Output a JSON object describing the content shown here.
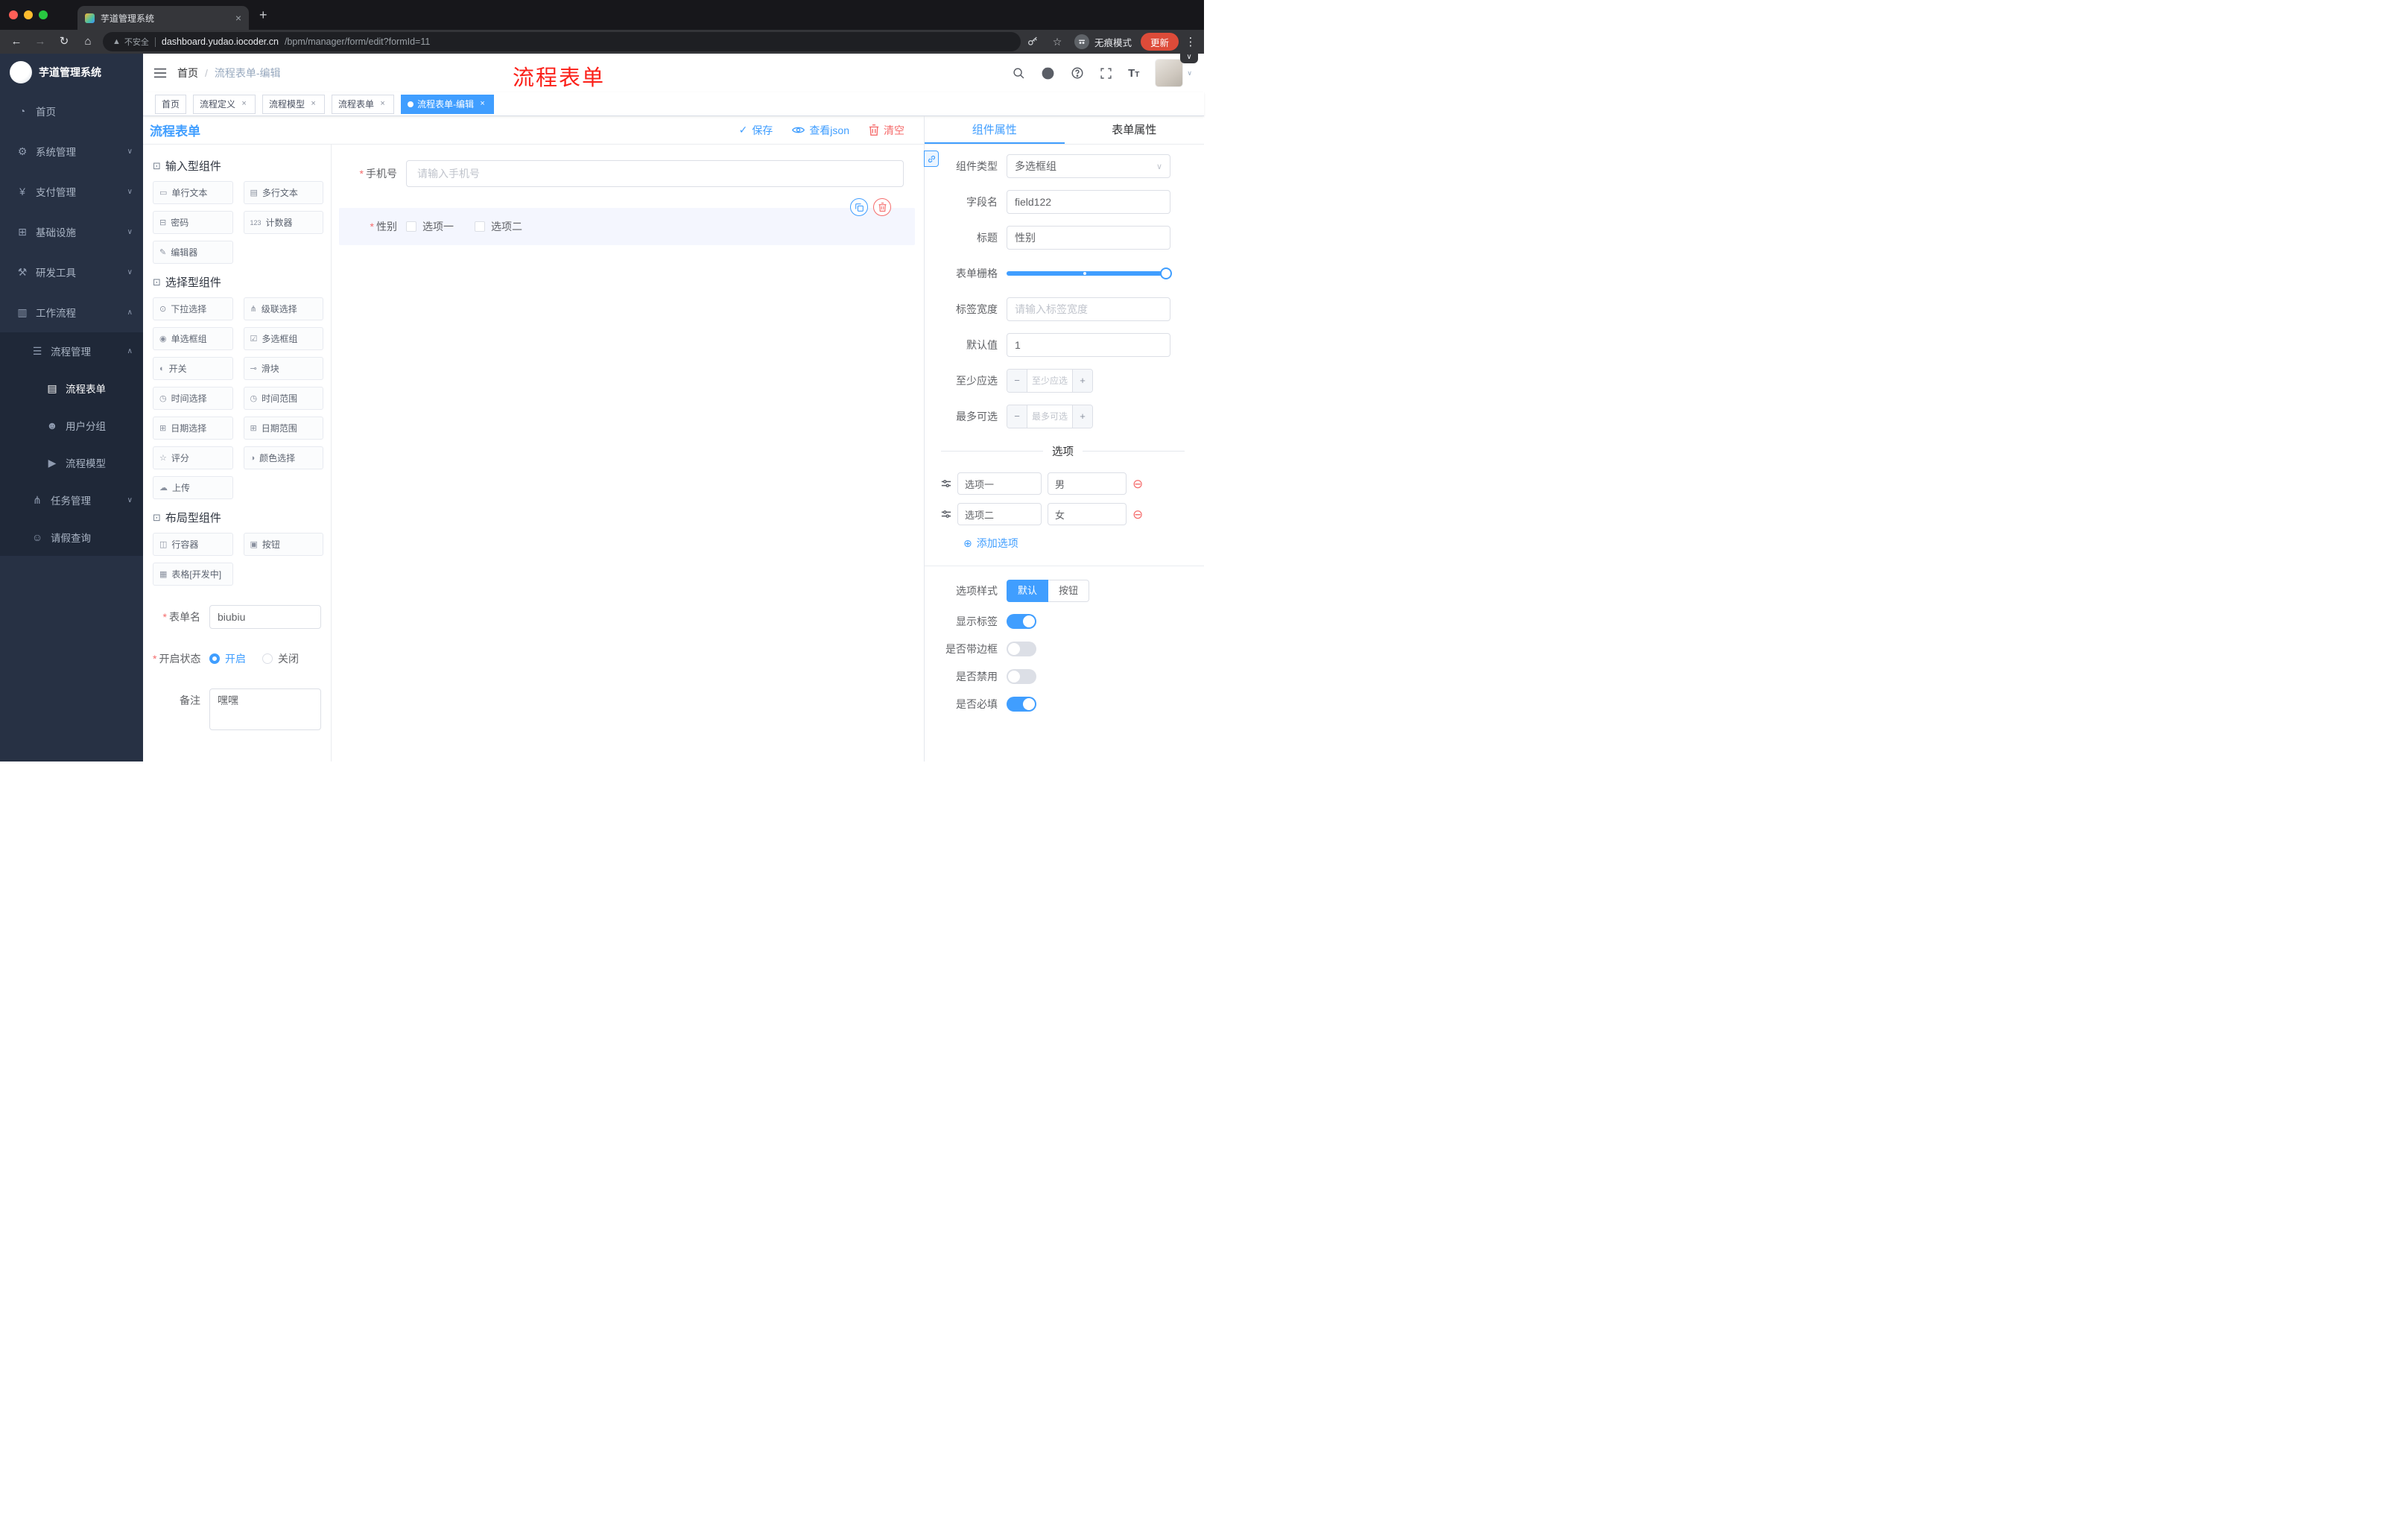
{
  "browser": {
    "tab_title": "芋道管理系统",
    "security": "不安全",
    "url_host": "dashboard.yudao.iocoder.cn",
    "url_path": "/bpm/manager/form/edit?formId=11",
    "incognito": "无痕模式",
    "update": "更新"
  },
  "sidebar": {
    "logo": "芋道管理系统",
    "items": {
      "home": "首页",
      "system": "系统管理",
      "pay": "支付管理",
      "infra": "基础设施",
      "dev": "研发工具",
      "workflow": "工作流程",
      "process_mgmt": "流程管理",
      "process_form": "流程表单",
      "user_group": "用户分组",
      "process_model": "流程模型",
      "task_mgmt": "任务管理",
      "leave_query": "请假查询"
    }
  },
  "header": {
    "breadcrumb_home": "首页",
    "breadcrumb_sep": "/",
    "breadcrumb_current": "流程表单-编辑",
    "annotation": "流程表单"
  },
  "tags": {
    "home": "首页",
    "t1": "流程定义",
    "t2": "流程模型",
    "t3": "流程表单",
    "active": "流程表单-编辑"
  },
  "page": {
    "title": "流程表单",
    "save": "保存",
    "view_json": "查看json",
    "clear": "清空"
  },
  "palette": {
    "sections": [
      {
        "title": "输入型组件",
        "items": [
          "单行文本",
          "多行文本",
          "密码",
          "计数器",
          "编辑器"
        ]
      },
      {
        "title": "选择型组件",
        "items": [
          "下拉选择",
          "级联选择",
          "单选框组",
          "多选框组",
          "开关",
          "滑块",
          "时间选择",
          "时间范围",
          "日期选择",
          "日期范围",
          "评分",
          "颜色选择",
          "上传"
        ]
      },
      {
        "title": "布局型组件",
        "items": [
          "行容器",
          "按钮",
          "表格[开发中]"
        ]
      }
    ],
    "form": {
      "name_label": "表单名",
      "name_value": "biubiu",
      "status_label": "开启状态",
      "status_on": "开启",
      "status_off": "关闭",
      "remark_label": "备注",
      "remark_value": "嘿嘿"
    }
  },
  "canvas": {
    "phone_label": "手机号",
    "phone_placeholder": "请输入手机号",
    "gender_label": "性别",
    "gender_opt1": "选项一",
    "gender_opt2": "选项二"
  },
  "props": {
    "tab_component": "组件属性",
    "tab_form": "表单属性",
    "type_label": "组件类型",
    "type_value": "多选框组",
    "field_label": "字段名",
    "field_value": "field122",
    "title_label": "标题",
    "title_value": "性别",
    "grid_label": "表单栅格",
    "width_label": "标签宽度",
    "width_placeholder": "请输入标签宽度",
    "default_label": "默认值",
    "default_value": "1",
    "min_label": "至少应选",
    "min_placeholder": "至少应选",
    "max_label": "最多可选",
    "max_placeholder": "最多可选",
    "options_title": "选项",
    "option_rows": [
      {
        "label": "选项一",
        "value": "男"
      },
      {
        "label": "选项二",
        "value": "女"
      }
    ],
    "add_option": "添加选项",
    "style_label": "选项样式",
    "style_default": "默认",
    "style_button": "按钮",
    "switch_show_label": "显示标签",
    "switch_border": "是否带边框",
    "switch_disabled": "是否禁用",
    "switch_required": "是否必填"
  },
  "icons": {
    "hamburger": "☰",
    "back": "←",
    "forward": "→",
    "reload": "↻",
    "home": "⌂",
    "warning": "▲",
    "star": "☆",
    "dots": "⋮",
    "chevron_down": "∨",
    "chevron_up": "∧",
    "close": "×",
    "plus": "+",
    "check": "✓",
    "section_cube": "⊡",
    "single_text": "▭",
    "multi_text": "▤",
    "password": "⊟",
    "counter": "123",
    "editor": "✎",
    "select": "⊙",
    "cascader": "⋔",
    "radio_group": "◉",
    "checkbox_group": "☑",
    "switch": "◐",
    "slider": "⊸",
    "time": "◷",
    "time_range": "◷",
    "date": "⊞",
    "date_range": "⊞",
    "rate": "☆",
    "color": "◑",
    "upload": "☁",
    "row_container": "◫",
    "button": "▣",
    "table": "▦",
    "menu_home": "◔",
    "menu_system": "⚙",
    "menu_pay": "¥",
    "menu_infra": "⊞",
    "menu_dev": "⚒",
    "menu_workflow": "▥",
    "menu_list": "☰",
    "menu_doc": "▤",
    "menu_users": "☻",
    "menu_send": "▶",
    "menu_task": "⋔",
    "menu_person": "☺",
    "minus": "−",
    "add": "⊕",
    "remove": "⊖"
  }
}
